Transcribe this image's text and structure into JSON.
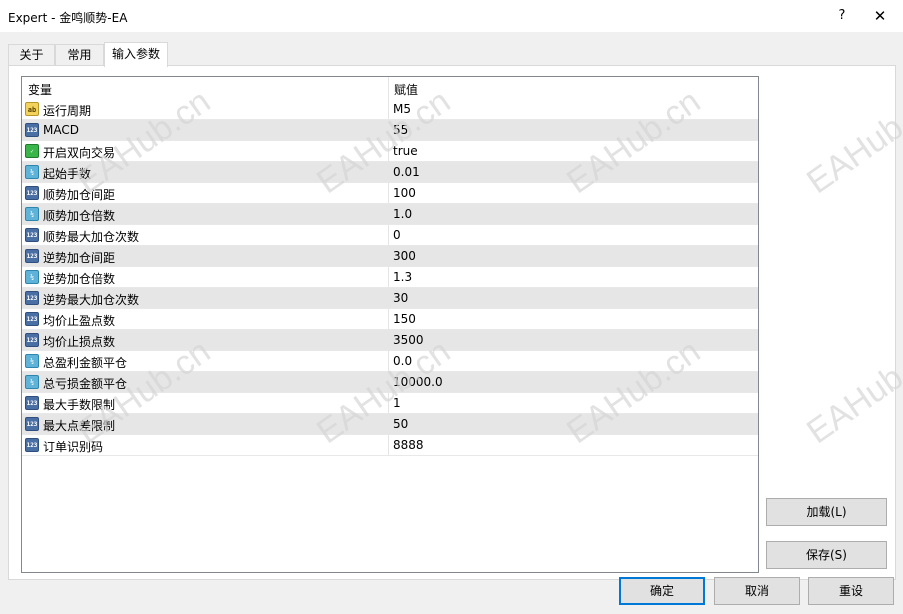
{
  "window": {
    "title": "Expert - 金鸣顺势-EA",
    "help": "?",
    "close": "✕"
  },
  "tabs": [
    {
      "label": "关于"
    },
    {
      "label": "常用"
    },
    {
      "label": "输入参数",
      "active": true
    }
  ],
  "grid": {
    "col_variable": "变量",
    "col_value": "赋值",
    "rows": [
      {
        "type": "str",
        "icon": "ab",
        "name": "运行周期",
        "value": "M5"
      },
      {
        "type": "int",
        "icon": "123",
        "name": "MACD",
        "value": "55"
      },
      {
        "type": "bool",
        "icon": "✓",
        "name": "开启双向交易",
        "value": "true"
      },
      {
        "type": "dbl",
        "icon": "½",
        "name": "起始手数",
        "value": "0.01"
      },
      {
        "type": "int",
        "icon": "123",
        "name": "顺势加仓间距",
        "value": "100"
      },
      {
        "type": "dbl",
        "icon": "½",
        "name": "顺势加仓倍数",
        "value": "1.0"
      },
      {
        "type": "int",
        "icon": "123",
        "name": "顺势最大加仓次数",
        "value": "0"
      },
      {
        "type": "int",
        "icon": "123",
        "name": "逆势加仓间距",
        "value": "300"
      },
      {
        "type": "dbl",
        "icon": "½",
        "name": "逆势加仓倍数",
        "value": "1.3"
      },
      {
        "type": "int",
        "icon": "123",
        "name": "逆势最大加仓次数",
        "value": "30"
      },
      {
        "type": "int",
        "icon": "123",
        "name": "均价止盈点数",
        "value": "150"
      },
      {
        "type": "int",
        "icon": "123",
        "name": "均价止损点数",
        "value": "3500"
      },
      {
        "type": "dbl",
        "icon": "½",
        "name": "总盈利金额平仓",
        "value": "0.0"
      },
      {
        "type": "dbl",
        "icon": "½",
        "name": "总亏损金额平仓",
        "value": "10000.0"
      },
      {
        "type": "int",
        "icon": "123",
        "name": "最大手数限制",
        "value": "1"
      },
      {
        "type": "int",
        "icon": "123",
        "name": "最大点差限制",
        "value": "50"
      },
      {
        "type": "int",
        "icon": "123",
        "name": "订单识别码",
        "value": "8888"
      }
    ]
  },
  "side_buttons": {
    "load": "加载(L)",
    "save": "保存(S)"
  },
  "footer_buttons": {
    "ok": "确定",
    "cancel": "取消",
    "reset": "重设"
  },
  "watermark": "EAHub.cn",
  "colors": {
    "accent": "#0078d7",
    "alt_row": "#e6e6e6",
    "button_face": "#e1e1e1"
  }
}
